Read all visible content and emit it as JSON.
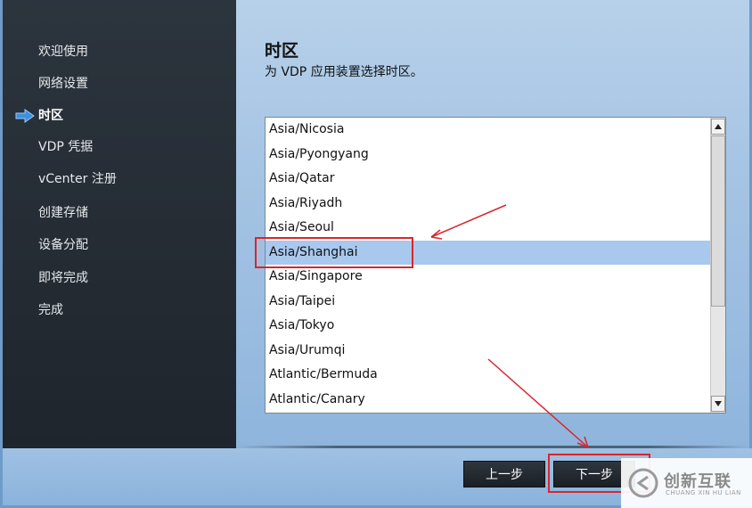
{
  "sidebar": {
    "items": [
      {
        "label": "欢迎使用"
      },
      {
        "label": "网络设置"
      },
      {
        "label": "时区",
        "active": true
      },
      {
        "label": "VDP 凭据"
      },
      {
        "label": "vCenter 注册"
      },
      {
        "label": "创建存储"
      },
      {
        "label": "设备分配"
      },
      {
        "label": "即将完成"
      },
      {
        "label": "完成"
      }
    ],
    "active_icon": "arrow-right-icon"
  },
  "main": {
    "title": "时区",
    "subtitle": "为 VDP 应用装置选择时区。",
    "timezones": [
      "Asia/Nicosia",
      "Asia/Pyongyang",
      "Asia/Qatar",
      "Asia/Riyadh",
      "Asia/Seoul",
      "Asia/Shanghai",
      "Asia/Singapore",
      "Asia/Taipei",
      "Asia/Tokyo",
      "Asia/Urumqi",
      "Atlantic/Bermuda",
      "Atlantic/Canary"
    ],
    "selected_timezone": "Asia/Shanghai"
  },
  "footer": {
    "back_label": "上一步",
    "next_label": "下一步"
  },
  "watermark": {
    "brand": "创新互联",
    "sub": "CHUANG XIN HU LIAN"
  },
  "colors": {
    "sidebar_bg": "#262d35",
    "selection": "#a9c8ee",
    "annotation_red": "#d9262b"
  }
}
